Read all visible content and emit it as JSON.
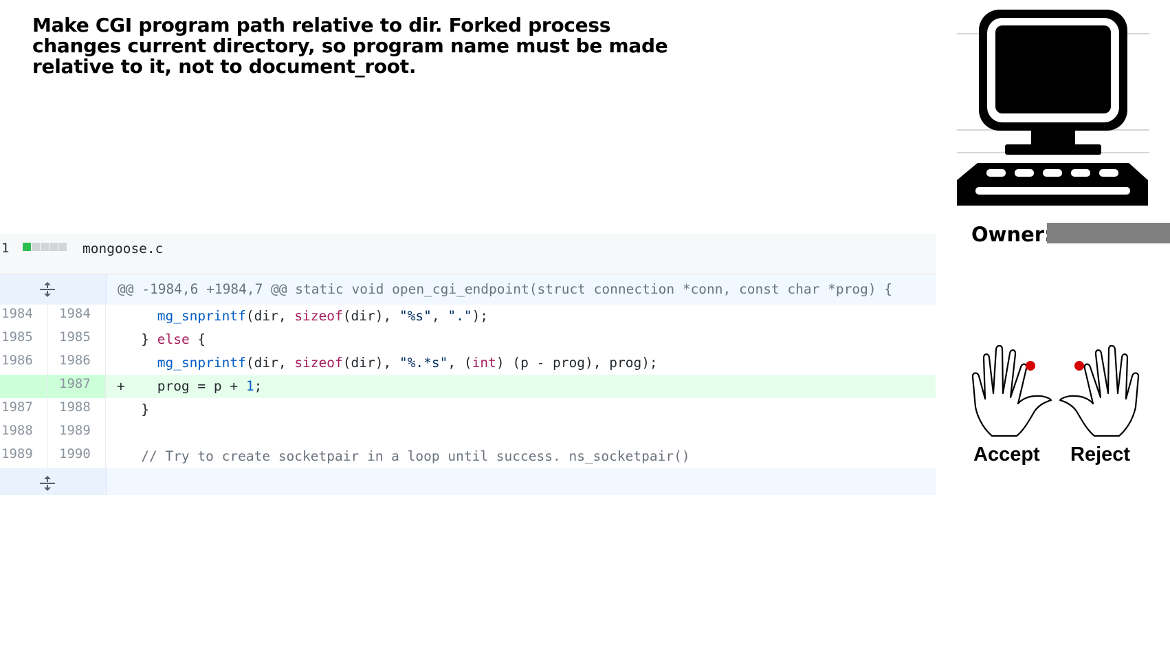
{
  "commit": {
    "message": "Make CGI program path relative to dir.  Forked process changes current directory, so program name must be made relative to it, not to document_root."
  },
  "diff": {
    "file_count": "1",
    "filename": "mongoose.c",
    "hunk_header": "@@ -1984,6 +1984,7 @@ static void open_cgi_endpoint(struct connection *conn, const char *prog) {",
    "lines": [
      {
        "old": "1984",
        "new": "1984",
        "prefix": " ",
        "type": "context"
      },
      {
        "old": "1985",
        "new": "1985",
        "prefix": " ",
        "type": "context"
      },
      {
        "old": "1986",
        "new": "1986",
        "prefix": " ",
        "type": "context"
      },
      {
        "old": "",
        "new": "1987",
        "prefix": "+",
        "type": "added"
      },
      {
        "old": "1987",
        "new": "1988",
        "prefix": " ",
        "type": "context"
      },
      {
        "old": "1988",
        "new": "1989",
        "prefix": " ",
        "type": "context"
      },
      {
        "old": "1989",
        "new": "1990",
        "prefix": " ",
        "type": "context"
      }
    ],
    "code": {
      "l0": [
        "    ",
        "mg_snprintf",
        "(dir, ",
        "sizeof",
        "(dir), ",
        "\"%s\"",
        ", ",
        "\".\"",
        ");"
      ],
      "l1": [
        "  } ",
        "else",
        " {"
      ],
      "l2": [
        "    ",
        "mg_snprintf",
        "(dir, ",
        "sizeof",
        "(dir), ",
        "\"%.*s\"",
        ", (",
        "int",
        ") (p - prog), prog);"
      ],
      "l3": [
        "    prog = p + ",
        "1",
        ";"
      ],
      "l4": [
        "  }"
      ],
      "l5": [
        ""
      ],
      "l6": [
        "  ",
        "// Try to create socketpair in a loop until success. ns_socketpair()"
      ]
    }
  },
  "review": {
    "owner_label": "Owner:",
    "accept_label": "Accept",
    "reject_label": "Reject"
  },
  "icons": {
    "computer": "computer-icon",
    "expand": "expand-icon",
    "hand": "hand-icon"
  },
  "colors": {
    "added_bg": "#e6ffed",
    "hunk_bg": "#f1f8ff",
    "keyword": "#d73a49",
    "function": "#005cc5",
    "string": "#032f62",
    "finger_marker": "#d40000"
  }
}
